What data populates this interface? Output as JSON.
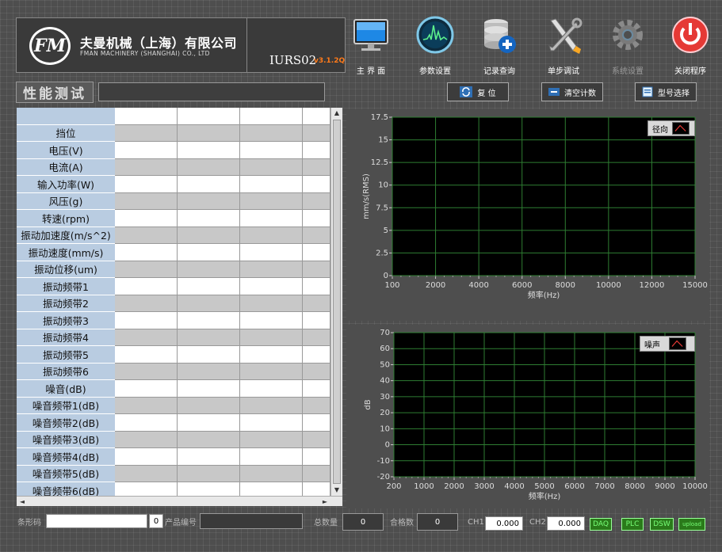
{
  "header": {
    "company_cn": "夫曼机械（上海）有限公司",
    "company_en": "FMAN MACHINERY (SHANGHAI) CO., LTD",
    "model": "IURS02",
    "version": "v3.1.2Q",
    "buttons": [
      {
        "label": "主 界 面",
        "icon": "monitor-icon",
        "enabled": true
      },
      {
        "label": "参数设置",
        "icon": "spectrum-gauge-icon",
        "enabled": true
      },
      {
        "label": "记录查询",
        "icon": "database-add-icon",
        "enabled": true
      },
      {
        "label": "单步调试",
        "icon": "tools-icon",
        "enabled": true
      },
      {
        "label": "系统设置",
        "icon": "gear-icon",
        "enabled": false
      },
      {
        "label": "关闭程序",
        "icon": "power-icon",
        "enabled": true
      }
    ]
  },
  "page": {
    "title": "性能测试",
    "reset_label": "复  位",
    "clear_label": "清空计数",
    "model_select_label": "型号选择"
  },
  "table": {
    "rows": [
      "",
      "挡位",
      "电压(V)",
      "电流(A)",
      "输入功率(W)",
      "风压(g)",
      "转速(rpm)",
      "振动加速度(m/s^2)",
      "振动速度(mm/s)",
      "振动位移(um)",
      "振动频带1",
      "振动频带2",
      "振动频带3",
      "振动频带4",
      "振动频带5",
      "振动频带6",
      "噪音(dB)",
      "噪音频带1(dB)",
      "噪音频带2(dB)",
      "噪音频带3(dB)",
      "噪音频带4(dB)",
      "噪音频带5(dB)",
      "噪音频带6(dB)"
    ]
  },
  "chart_data": [
    {
      "type": "line",
      "legend": "径向",
      "ylabel": "mm/s(RMS)",
      "xlabel": "频率(Hz)",
      "ylim": [
        0,
        17.5
      ],
      "yticks": [
        "17.5",
        "15",
        "12.5",
        "10",
        "7.5",
        "5",
        "2.5",
        "0"
      ],
      "xticks": [
        "100",
        "2000",
        "4000",
        "6000",
        "8000",
        "10000",
        "12000",
        "15000"
      ],
      "series": [],
      "grid": true,
      "legend_position": "top-right"
    },
    {
      "type": "line",
      "legend": "噪声",
      "ylabel": "dB",
      "xlabel": "频率(Hz)",
      "ylim": [
        -20,
        70
      ],
      "yticks": [
        "70",
        "60",
        "50",
        "40",
        "30",
        "20",
        "10",
        "0",
        "-10",
        "-20"
      ],
      "xticks": [
        "200",
        "1000",
        "2000",
        "3000",
        "4000",
        "5000",
        "6000",
        "7000",
        "8000",
        "9000",
        "10000"
      ],
      "series": [],
      "grid": true,
      "legend_position": "top-right"
    }
  ],
  "footer": {
    "barcode_label": "条形码",
    "barcode_value": "",
    "barcode_count": "0",
    "product_no_label": "产品编号",
    "product_no_value": "",
    "total_label": "总数量",
    "total_value": "0",
    "pass_label": "合格数",
    "pass_value": "0",
    "ch1_label": "CH1",
    "ch1_value": "0.000",
    "ch2_label": "CH2",
    "ch2_value": "0.000",
    "indicators": [
      "DAQ",
      "PLC",
      "DSW",
      "upload"
    ]
  },
  "colors": {
    "background": "#4e4e4e",
    "table_label": "#b9cce1",
    "grid_line": "#2e7d32",
    "version": "#ff7a1a",
    "led": "#2a7a1a"
  }
}
